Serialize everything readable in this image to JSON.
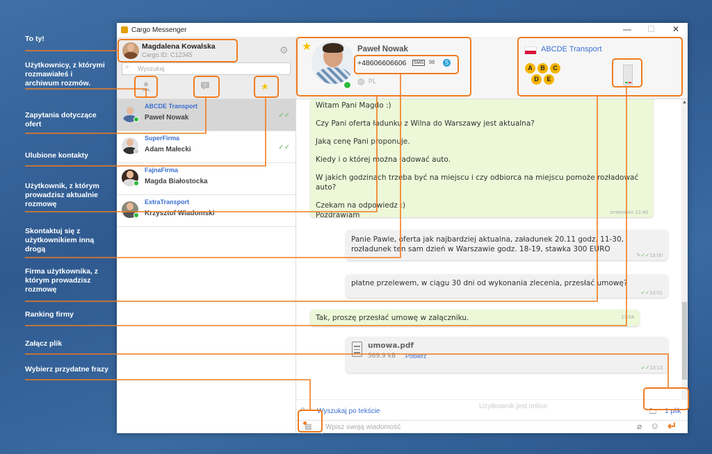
{
  "annotations": [
    "To ty!",
    "Użytkownicy, z którymi rozmawiałeś i archiwum rozmów.",
    "Zapytania dotyczące ofert",
    "Ulubione kontakty",
    "Użytkownik, z którym prowadzisz aktualnie rozmowę",
    "Skontaktuj się z użytkownikiem inną drogą",
    "Firma użytkownika, z którym prowadzisz rozmowę",
    "Ranking firmy",
    "Załącz plik",
    "Wybierz przydatne frazy"
  ],
  "window": {
    "title": "Cargo Messenger",
    "minimize": "—",
    "maximize": "☐",
    "close": "✕"
  },
  "me": {
    "name": "Magdalena Kowalska",
    "cargo_id": "Cargo.ID: C12345"
  },
  "search": {
    "placeholder": "Wyszukaj"
  },
  "contacts": [
    {
      "company": "ABCDE Transport",
      "person": "Paweł Nowak",
      "read": "✓✓"
    },
    {
      "company": "SuperFirma",
      "person": "Adam Małecki",
      "read": "✓✓"
    },
    {
      "company": "FajnaFirma",
      "person": "Magda Białostocka",
      "read": ""
    },
    {
      "company": "ExtraTransport",
      "person": "Krzysztof Wiadomski",
      "read": ""
    }
  ],
  "header": {
    "name": "Paweł Nowak",
    "phone": "+48606606606",
    "sms": "SMS",
    "lang": "PL",
    "company": "ABCDE Transport",
    "rating_badges": [
      "A",
      "B",
      "C",
      "D",
      "E"
    ]
  },
  "messages": [
    {
      "lines": [
        "Witam Pani Magdo :)",
        "Czy Pani oferta ładunku z Wilna do Warszawy jest aktualna?",
        "Jaką cenę Pani proponuje.",
        "Kiedy i o której można ładować auto.",
        "W jakich godzinach trzeba być na miejscu i czy odbiorca na miejscu pomoże rozładować auto?",
        "Czekam na odpowiedz :)\nPozdrawiam"
      ],
      "meta": "zmieniono 12:46"
    },
    {
      "text": "Panie Pawle, oferta jak najbardziej aktualna, załadunek 20.11 godz. 11-30, rozładunek ten sam dzień w Warszawie godz. 18-19, stawka 300 EURO",
      "time": "13:00"
    },
    {
      "text": "płatne przelewem, w ciągu 30 dni od wykonania zlecenia, przesłać umowę?",
      "time": "13:01"
    },
    {
      "text": "Tak, proszę przesłać umowę w załączniku.",
      "time": "13:04"
    }
  ],
  "file": {
    "name": "umowa.pdf",
    "size": "569.9 kB",
    "download": "Pobierz",
    "time": "13:13"
  },
  "bottom": {
    "search_text": "Wyszukaj po tekście",
    "status": "Użytkownik jest online",
    "files": "1 plik"
  },
  "input": {
    "placeholder": "Wpisz swoją wiadomość"
  },
  "colors": {
    "accent": "#f07b1f",
    "link": "#3a6fd1",
    "online": "#2bbb3b",
    "incoming": "#ecf8d8"
  }
}
